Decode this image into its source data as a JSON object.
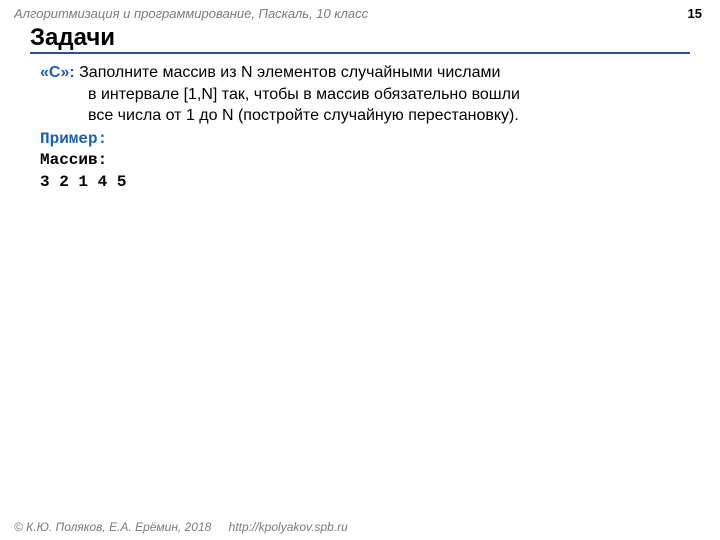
{
  "header": {
    "breadcrumb": "Алгоритмизация и программирование, Паскаль, 10 класс",
    "page": "15"
  },
  "title": "Задачи",
  "task": {
    "label": "«С»: ",
    "line1": "Заполните массив из N элементов случайными числами",
    "line2": "в интервале [1,N] так, чтобы в массив обязательно вошли",
    "line3": "все числа от 1 до N (постройте случайную перестановку)."
  },
  "example": {
    "label": "Пример:",
    "array_label": "Массив:",
    "array_values": "3 2 1 4 5"
  },
  "footer": {
    "copyright": "© К.Ю. Поляков, Е.А. Ерёмин, 2018",
    "url": "http://kpolyakov.spb.ru"
  }
}
